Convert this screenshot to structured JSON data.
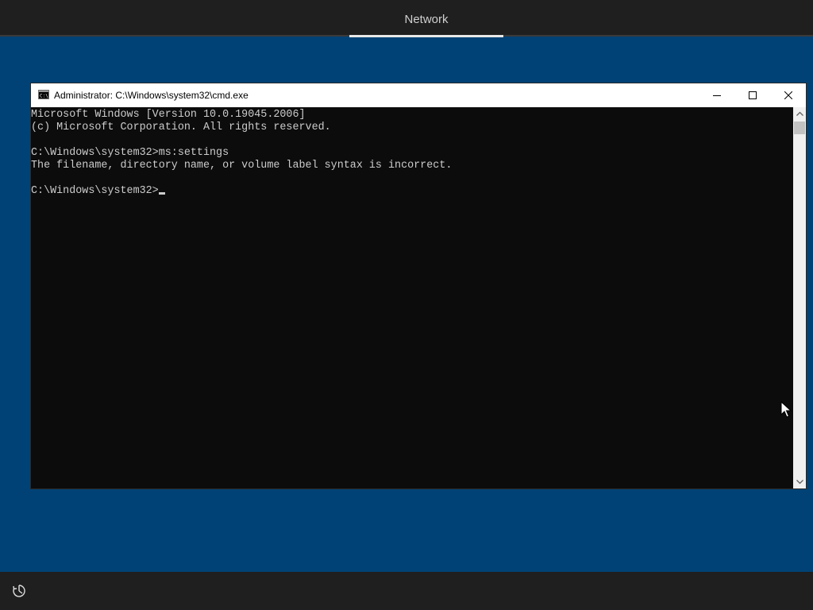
{
  "top_bar": {
    "tab_label": "Network"
  },
  "cmd_window": {
    "title": "Administrator: C:\\Windows\\system32\\cmd.exe",
    "icon": "cmd-icon",
    "controls": {
      "minimize": "minimize-icon",
      "maximize": "maximize-icon",
      "close": "close-icon"
    },
    "console_lines": [
      "Microsoft Windows [Version 10.0.19045.2006]",
      "(c) Microsoft Corporation. All rights reserved.",
      "",
      "C:\\Windows\\system32>ms:settings",
      "The filename, directory name, or volume label syntax is incorrect.",
      "",
      "C:\\Windows\\system32>"
    ]
  },
  "bottom_bar": {
    "icon": "ease-of-access-icon"
  },
  "colors": {
    "desktop": "#004275",
    "bars": "#1f1f1f",
    "console_bg": "#0c0c0c",
    "console_text": "#cccccc"
  }
}
